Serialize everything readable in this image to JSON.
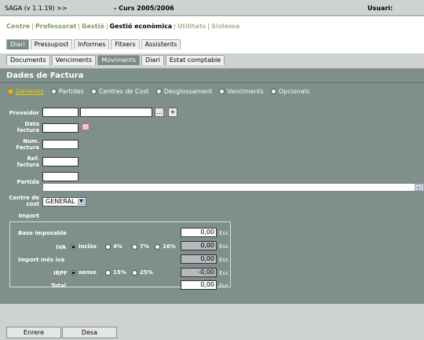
{
  "app": {
    "title": "SAGA (v 1.1.19) >>",
    "course": "- Curs 2005/2006",
    "user_label": "Usuari:"
  },
  "mainnav": {
    "items": [
      "Centre",
      "Professorat",
      "Gestió",
      "Gestió econòmica",
      "Utilitats",
      "Sistema"
    ],
    "sep": "|",
    "active": "Gestió econòmica"
  },
  "tabs": [
    "Diari",
    "Pressupost",
    "Informes",
    "Fitxers",
    "Assistents"
  ],
  "tabs_selected": "Diari",
  "subtabs": [
    "Documents",
    "Venciments",
    "Moviments",
    "Diari",
    "Estat comptable"
  ],
  "subtabs_selected": "Moviments",
  "section_title": "Dades de Factura",
  "radio_tabs": [
    "Generals",
    "Partides",
    "Centres de Cost",
    "Desglossament",
    "Venciments",
    "Opcionals"
  ],
  "radio_tabs_selected": "Generals",
  "form": {
    "proveidor": "Proveidor",
    "proveidor_btn": "...",
    "proveidor_add": "+",
    "data_factura_1": "Data",
    "data_factura_2": "factura",
    "num_factura_1": "Num.",
    "num_factura_2": "Factura",
    "ref_factura_1": "Ref.",
    "ref_factura_2": "factura",
    "partida": "Partida",
    "centre_cost_1": "Centre de",
    "centre_cost_2": "cost",
    "centre_cost_value": "GENERAL",
    "import": "Import"
  },
  "import_box": {
    "base_imposable": "Base imposable",
    "base_value": "0,00",
    "iva": "IVA",
    "iva_options": [
      "inclòs",
      "4%",
      "7%",
      "16%"
    ],
    "iva_value": "0,00",
    "import_mes_iva": "Import més iva",
    "import_mes_iva_value": "0,00",
    "irpf": "IRPF",
    "irpf_options": [
      "sense",
      "15%",
      "25%"
    ],
    "irpf_value": "-0,00",
    "total": "Total",
    "total_value": "0,00",
    "eur": "Eur."
  },
  "buttons": {
    "back": "Enrere",
    "save": "Desa"
  }
}
